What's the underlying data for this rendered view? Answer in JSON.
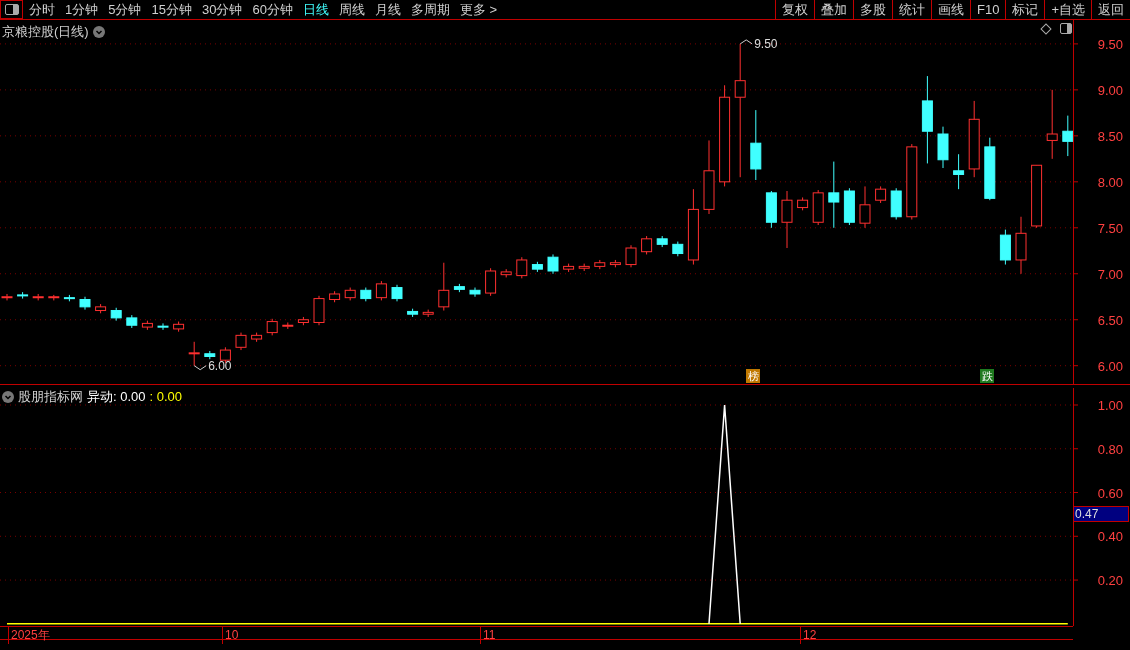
{
  "toolbar": {
    "periods": [
      {
        "label": "分时",
        "selected": false
      },
      {
        "label": "1分钟",
        "selected": false
      },
      {
        "label": "5分钟",
        "selected": false
      },
      {
        "label": "15分钟",
        "selected": false
      },
      {
        "label": "30分钟",
        "selected": false
      },
      {
        "label": "60分钟",
        "selected": false
      },
      {
        "label": "日线",
        "selected": true
      },
      {
        "label": "周线",
        "selected": false
      },
      {
        "label": "月线",
        "selected": false
      },
      {
        "label": "多周期",
        "selected": false
      },
      {
        "label": "更多 >",
        "selected": false
      }
    ],
    "actions": [
      "复权",
      "叠加",
      "多股",
      "统计",
      "画线",
      "F10",
      "标记",
      "+自选",
      "返回"
    ]
  },
  "price_pane": {
    "title": "京粮控股(日线)",
    "max_label": "9.50",
    "min_label": "6.00",
    "markers": [
      {
        "label": "榜",
        "color": "#c07800"
      },
      {
        "label": "跌",
        "color": "#1f7a1f"
      }
    ],
    "chart_data": {
      "type": "candlestick",
      "grid": true,
      "ylim": [
        5.79,
        9.76
      ],
      "yticks": [
        {
          "value": 9.5,
          "label": "9.50"
        },
        {
          "value": 9,
          "label": "9.00"
        },
        {
          "value": 8.5,
          "label": "8.50"
        },
        {
          "value": 8,
          "label": "8.00"
        },
        {
          "value": 7.5,
          "label": "7.50"
        },
        {
          "value": 7,
          "label": "7.00"
        },
        {
          "value": 6.5,
          "label": "6.50"
        },
        {
          "value": 6,
          "label": "6.00"
        }
      ],
      "ohlc": [
        [
          6.74,
          6.78,
          6.71,
          6.75
        ],
        [
          6.77,
          6.8,
          6.73,
          6.76
        ],
        [
          6.74,
          6.78,
          6.71,
          6.75
        ],
        [
          6.74,
          6.77,
          6.71,
          6.75
        ],
        [
          6.74,
          6.77,
          6.7,
          6.73
        ],
        [
          6.72,
          6.75,
          6.61,
          6.64
        ],
        [
          6.6,
          6.67,
          6.57,
          6.64
        ],
        [
          6.6,
          6.63,
          6.49,
          6.52
        ],
        [
          6.52,
          6.55,
          6.41,
          6.44
        ],
        [
          6.42,
          6.49,
          6.39,
          6.46
        ],
        [
          6.43,
          6.46,
          6.39,
          6.42
        ],
        [
          6.4,
          6.48,
          6.37,
          6.45
        ],
        [
          6.13,
          6.26,
          6.0,
          6.14
        ],
        [
          6.13,
          6.16,
          6.07,
          6.1
        ],
        [
          6.06,
          6.2,
          6.03,
          6.17
        ],
        [
          6.2,
          6.36,
          6.17,
          6.33
        ],
        [
          6.29,
          6.36,
          6.26,
          6.33
        ],
        [
          6.36,
          6.51,
          6.33,
          6.48
        ],
        [
          6.43,
          6.47,
          6.4,
          6.44
        ],
        [
          6.47,
          6.53,
          6.44,
          6.5
        ],
        [
          6.47,
          6.76,
          6.44,
          6.73
        ],
        [
          6.72,
          6.81,
          6.69,
          6.78
        ],
        [
          6.74,
          6.85,
          6.71,
          6.82
        ],
        [
          6.82,
          6.85,
          6.7,
          6.73
        ],
        [
          6.74,
          6.92,
          6.71,
          6.89
        ],
        [
          6.85,
          6.88,
          6.7,
          6.73
        ],
        [
          6.59,
          6.62,
          6.53,
          6.56
        ],
        [
          6.56,
          6.61,
          6.53,
          6.58
        ],
        [
          6.64,
          7.12,
          6.6,
          6.82
        ],
        [
          6.86,
          6.89,
          6.8,
          6.83
        ],
        [
          6.82,
          6.85,
          6.75,
          6.78
        ],
        [
          6.79,
          7.06,
          6.76,
          7.03
        ],
        [
          6.99,
          7.05,
          6.96,
          7.02
        ],
        [
          6.98,
          7.18,
          6.95,
          7.15
        ],
        [
          7.1,
          7.13,
          7.02,
          7.05
        ],
        [
          7.18,
          7.21,
          7.0,
          7.03
        ],
        [
          7.05,
          7.11,
          7.02,
          7.08
        ],
        [
          7.06,
          7.11,
          7.03,
          7.08
        ],
        [
          7.08,
          7.15,
          7.05,
          7.12
        ],
        [
          7.1,
          7.15,
          7.07,
          7.12
        ],
        [
          7.1,
          7.31,
          7.07,
          7.28
        ],
        [
          7.24,
          7.41,
          7.21,
          7.38
        ],
        [
          7.38,
          7.41,
          7.29,
          7.32
        ],
        [
          7.32,
          7.35,
          7.19,
          7.22
        ],
        [
          7.15,
          7.92,
          7.1,
          7.7
        ],
        [
          7.7,
          8.45,
          7.65,
          8.12
        ],
        [
          8.0,
          9.05,
          7.95,
          8.92
        ],
        [
          8.92,
          9.5,
          8.05,
          9.1
        ],
        [
          8.42,
          8.78,
          8.02,
          8.14
        ],
        [
          7.88,
          7.9,
          7.5,
          7.56
        ],
        [
          7.56,
          7.9,
          7.28,
          7.8
        ],
        [
          7.72,
          7.83,
          7.69,
          7.8
        ],
        [
          7.56,
          7.91,
          7.53,
          7.88
        ],
        [
          7.88,
          8.22,
          7.5,
          7.78
        ],
        [
          7.9,
          7.93,
          7.53,
          7.56
        ],
        [
          7.55,
          7.95,
          7.5,
          7.75
        ],
        [
          7.8,
          7.95,
          7.77,
          7.92
        ],
        [
          7.9,
          7.93,
          7.59,
          7.62
        ],
        [
          7.62,
          8.41,
          7.59,
          8.38
        ],
        [
          8.88,
          9.15,
          8.2,
          8.55
        ],
        [
          8.52,
          8.6,
          8.15,
          8.24
        ],
        [
          8.12,
          8.3,
          7.92,
          8.08
        ],
        [
          8.14,
          8.88,
          8.05,
          8.68
        ],
        [
          8.38,
          8.48,
          7.8,
          7.82
        ],
        [
          7.42,
          7.48,
          7.1,
          7.15
        ],
        [
          7.15,
          7.62,
          7.0,
          7.44
        ],
        [
          7.52,
          8.18,
          7.5,
          8.18
        ],
        [
          8.45,
          9.0,
          8.25,
          8.52
        ],
        [
          8.55,
          8.72,
          8.28,
          8.44
        ]
      ]
    }
  },
  "indicator_pane": {
    "name": "股朋指标网",
    "legend": [
      ": 0.00",
      ": 0.00"
    ],
    "cursor_value": "0.47",
    "chart_data": {
      "type": "line",
      "grid": true,
      "ylim": [
        -0.01,
        1
      ],
      "yticks": [
        {
          "value": 1,
          "label": "1.00"
        },
        {
          "value": 0.8,
          "label": "0.80"
        },
        {
          "value": 0.6,
          "label": "0.60"
        },
        {
          "value": 0.4,
          "label": "0.40"
        },
        {
          "value": 0.2,
          "label": "0.20"
        }
      ],
      "series": [
        {
          "name": "异动",
          "color": "#ffffff",
          "values": [
            null,
            null,
            null,
            null,
            null,
            null,
            null,
            null,
            null,
            null,
            null,
            null,
            null,
            null,
            null,
            null,
            null,
            null,
            null,
            null,
            null,
            null,
            null,
            null,
            null,
            null,
            null,
            null,
            null,
            null,
            null,
            null,
            null,
            null,
            null,
            null,
            null,
            null,
            null,
            null,
            null,
            null,
            null,
            null,
            null,
            0,
            1,
            0,
            null,
            null,
            null,
            null,
            null,
            null,
            null,
            null,
            null,
            null,
            null,
            null,
            null,
            null,
            null,
            null,
            null,
            null,
            null,
            null,
            null
          ]
        },
        {
          "color": "#ffff00",
          "values": [
            0,
            0,
            0,
            0,
            0,
            0,
            0,
            0,
            0,
            0,
            0,
            0,
            0,
            0,
            0,
            0,
            0,
            0,
            0,
            0,
            0,
            0,
            0,
            0,
            0,
            0,
            0,
            0,
            0,
            0,
            0,
            0,
            0,
            0,
            0,
            0,
            0,
            0,
            0,
            0,
            0,
            0,
            0,
            0,
            0,
            0,
            0,
            0,
            0,
            0,
            0,
            0,
            0,
            0,
            0,
            0,
            0,
            0,
            0,
            0,
            0,
            0,
            0,
            0,
            0,
            0,
            0,
            0,
            0
          ]
        }
      ]
    }
  },
  "date_axis": [
    "2025年",
    "10",
    "11",
    "12"
  ]
}
